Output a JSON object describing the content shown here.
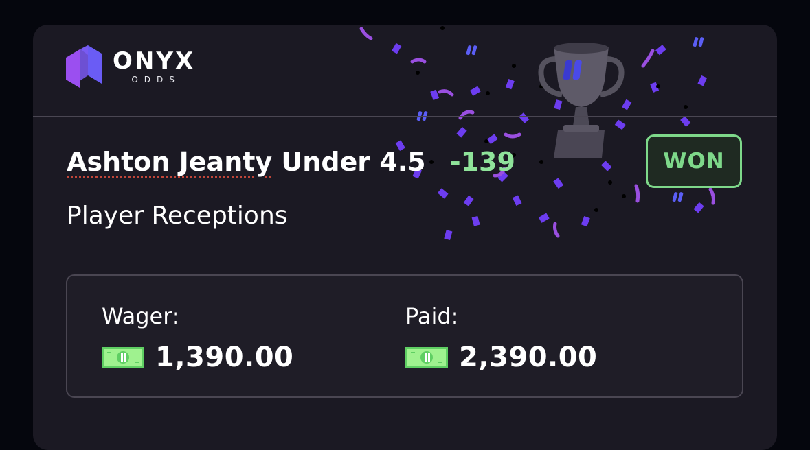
{
  "brand": {
    "name": "ONYX",
    "sub": "ODDS"
  },
  "bet": {
    "player": "Ashton Jeanty",
    "selection": "Under 4.5",
    "odds": "-139",
    "market": "Player Receptions",
    "status": "WON"
  },
  "amounts": {
    "wager_label": "Wager:",
    "wager_value": "1,390.00",
    "paid_label": "Paid:",
    "paid_value": "2,390.00"
  },
  "colors": {
    "background": "#05060d",
    "card": "#1b1923",
    "won_green": "#7ed88a",
    "odds_green": "#8fe39a",
    "logo_purple": "#8b5cf6",
    "confetti_purple": "#6d3df0"
  },
  "icons": [
    "logo-mark-icon",
    "trophy-icon",
    "cash-icon"
  ]
}
